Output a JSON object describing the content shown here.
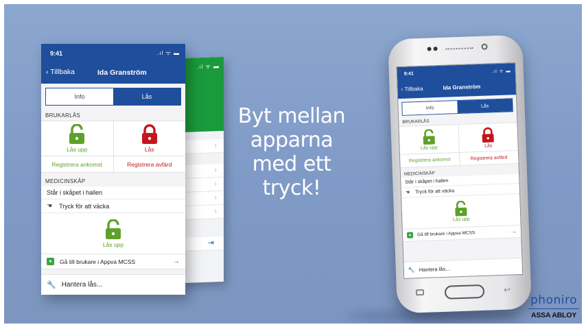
{
  "headline": {
    "lines": [
      "Byt mellan",
      "apparna",
      "med ett",
      "tryck!"
    ]
  },
  "app": {
    "status_time": "9:41",
    "status_icons": ".ıl ᯤ ▬",
    "back_label": "Tillbaka",
    "user_name": "Ida Granström",
    "tabs": [
      {
        "label": "Info",
        "active": false
      },
      {
        "label": "Lås",
        "active": true
      }
    ],
    "user_locks_section": "BRUKARLÅS",
    "unlock_label": "Lås upp",
    "lock_label": "Lås",
    "register_arrival": "Registrera ankomst",
    "register_departure": "Registrera avfärd",
    "cabinet_section": "MEDICINSKÅP",
    "cabinet_location": "Står i skåpet i hallen",
    "wake_prompt": "Tryck för att väcka",
    "cabinet_unlock_label": "Lås upp",
    "goto_mcss": "Gå till brukare i Appva MCSS",
    "manage_locks": "Hantera lås..."
  },
  "back_app": {
    "status_icons": ".ıl ᯤ ▬"
  },
  "brand": {
    "name": "phoniro",
    "sub": "ASSA ABLOY"
  },
  "colors": {
    "background": "#8ba7cf",
    "app_header": "#1e4e9c",
    "unlock_green": "#5ea12a",
    "lock_red": "#c3161d",
    "back_app_green": "#1a9a3c"
  },
  "icons": {
    "unlock": "padlock-open-icon",
    "lock": "padlock-closed-icon",
    "wake": "hand-tap-icon",
    "mcss": "map-pin-app-icon",
    "manage": "wrench-icon"
  }
}
